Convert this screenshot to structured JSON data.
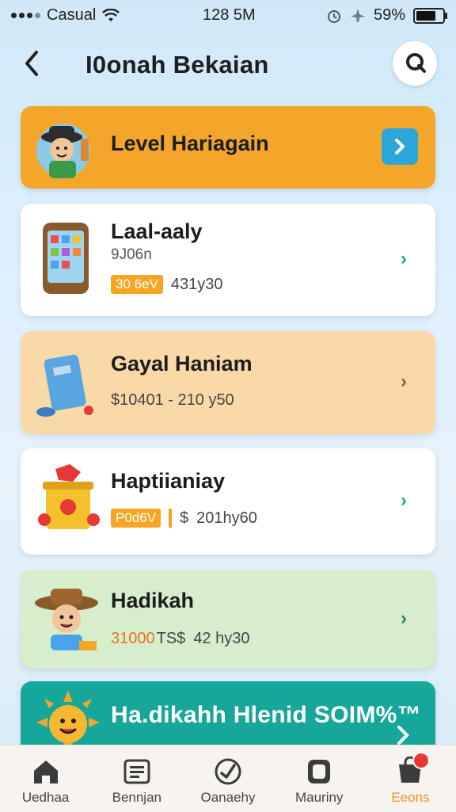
{
  "status_bar": {
    "carrier": "Casual",
    "time": "128 5M",
    "battery": "59%"
  },
  "header": {
    "title": "I0onah Bekaian",
    "back_icon": "back-arrow-icon",
    "search_icon": "search-icon"
  },
  "cards": [
    {
      "title": "Level Hariagain",
      "bg": "#f4a62a",
      "chevron_color": "#2aa6d9"
    },
    {
      "title": "Laal-aaly",
      "subtitle": "9J06n",
      "badge": "30 6eV",
      "meta": "431y30",
      "bg": "#ffffff",
      "chevron_color": "#1aa3a3"
    },
    {
      "title": "Gayal Haniam",
      "meta": "$10401 - 210 y50",
      "bg": "#fad9a8",
      "chevron_color": "#8a5a44"
    },
    {
      "title": "Haptiianiay",
      "badge": "P0d6V",
      "currency": "$",
      "meta": "201hy60",
      "bg": "#ffffff",
      "chevron_color": "#1aa3a3"
    },
    {
      "title": "Hadikah",
      "price": "31000",
      "price_suffix": "TS$",
      "meta": "42 hy30",
      "bg": "#d7eecd",
      "chevron_color": "#2d7d6a"
    },
    {
      "title": "Ha.dikahh Hlenid SOIM%™",
      "bg": "#16a79a"
    }
  ],
  "nav": [
    {
      "label": "Uedhaa",
      "icon": "home-icon"
    },
    {
      "label": "Bennjan",
      "icon": "list-icon"
    },
    {
      "label": "Oanaehy",
      "icon": "compass-icon"
    },
    {
      "label": "Mauriny",
      "icon": "wallet-icon"
    },
    {
      "label": "Eeons",
      "icon": "store-icon",
      "active": true
    }
  ]
}
